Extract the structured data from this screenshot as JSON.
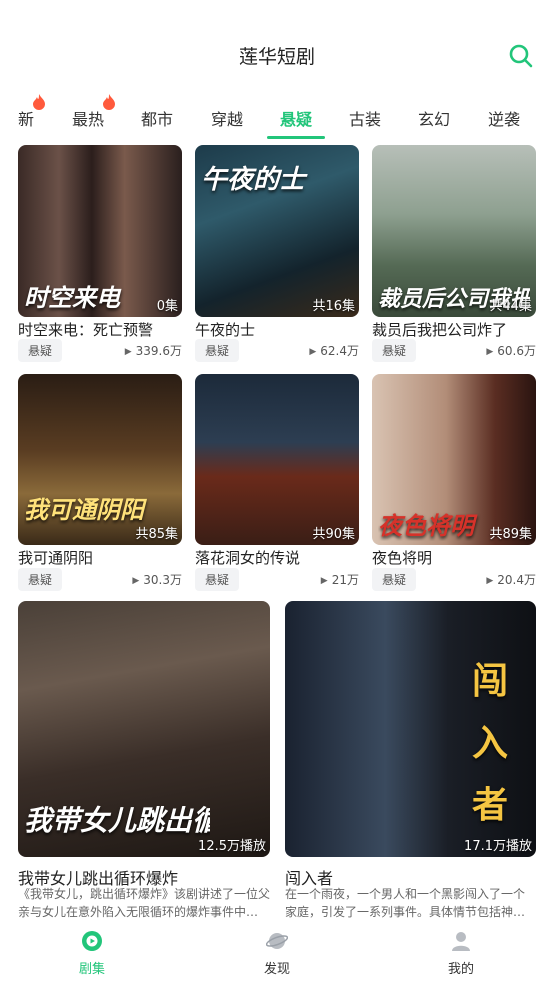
{
  "header": {
    "title": "莲华短剧",
    "search_icon": "search-icon"
  },
  "tabs": [
    {
      "label": "新",
      "hot": true
    },
    {
      "label": "最热",
      "hot": true
    },
    {
      "label": "都市",
      "hot": false
    },
    {
      "label": "穿越",
      "hot": false
    },
    {
      "label": "悬疑",
      "hot": false,
      "active": true
    },
    {
      "label": "古装",
      "hot": false
    },
    {
      "label": "玄幻",
      "hot": false
    },
    {
      "label": "逆袭",
      "hot": false
    }
  ],
  "accent_color": "#22c57a",
  "grid": [
    {
      "name": "时空来电：死亡预警",
      "tag": "悬疑",
      "plays": "339.6万",
      "episodes": "0集",
      "poster_text": "时空来电"
    },
    {
      "name": "午夜的士",
      "tag": "悬疑",
      "plays": "62.4万",
      "episodes": "共16集",
      "poster_text": "午夜的士"
    },
    {
      "name": "裁员后我把公司炸了",
      "tag": "悬疑",
      "plays": "60.6万",
      "episodes": "共44集",
      "poster_text": "裁员后公司我把炸"
    },
    {
      "name": "我可通阴阳",
      "tag": "悬疑",
      "plays": "30.3万",
      "episodes": "共85集",
      "poster_text": "我可通阴阳"
    },
    {
      "name": "落花洞女的传说",
      "tag": "悬疑",
      "plays": "21万",
      "episodes": "共90集",
      "poster_text": ""
    },
    {
      "name": "夜色将明",
      "tag": "悬疑",
      "plays": "20.4万",
      "episodes": "共89集",
      "poster_text": "夜色将明"
    }
  ],
  "featured": [
    {
      "name": "我带女儿跳出循环爆炸",
      "plays": "12.5万播放",
      "desc": "《我带女儿，跳出循环爆炸》该剧讲述了一位父亲与女儿在意外陷入无限循环的爆炸事件中，努力寻找真相的故事。",
      "poster_text": "我带女儿跳出循环"
    },
    {
      "name": "闯入者",
      "plays": "17.1万播放",
      "desc": "在一个雨夜，一个男人和一个黑影闯入了一个家庭，引发了一系列事件。具体情节包括神秘的跟踪与对峙。",
      "poster_text": "闯入者"
    }
  ],
  "bottom_nav": [
    {
      "label": "剧集",
      "icon": "play-circle-icon",
      "active": true
    },
    {
      "label": "发现",
      "icon": "planet-icon",
      "active": false
    },
    {
      "label": "我的",
      "icon": "user-icon",
      "active": false
    }
  ]
}
